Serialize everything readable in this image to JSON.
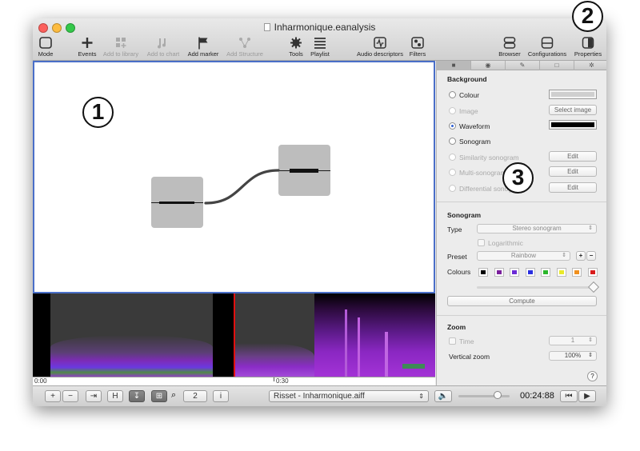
{
  "window": {
    "title": "Inharmonique.eanalysis"
  },
  "toolbar": {
    "mode": "Mode",
    "events": "Events",
    "add_to_library": "Add to library",
    "add_to_chart": "Add to chart",
    "add_marker": "Add marker",
    "add_structure": "Add Structure",
    "tools": "Tools",
    "playlist": "Playlist",
    "audio_descriptors": "Audio descriptors",
    "filters": "Filters",
    "browser": "Browser",
    "configurations": "Configurations",
    "properties": "Properties"
  },
  "timeline": {
    "start": "0:00",
    "mark": "0:30"
  },
  "bottombar": {
    "plus": "+",
    "minus": "−",
    "h": "H",
    "zoom_value": "2",
    "info": "i",
    "file": "Risset - Inharmonique.aiff",
    "time": "00:24:88"
  },
  "panel": {
    "background": {
      "title": "Background",
      "colour": "Colour",
      "image": "Image",
      "select_image": "Select image",
      "waveform": "Waveform",
      "sonogram": "Sonogram",
      "similarity": "Similarity sonogram",
      "multi": "Multi-sonogram",
      "differential": "Differential sonogram",
      "edit": "Edit"
    },
    "sonogram": {
      "title": "Sonogram",
      "type_label": "Type",
      "type_value": "Stereo sonogram",
      "logarithmic": "Logarithmic",
      "preset_label": "Preset",
      "preset_value": "Rainbow",
      "colours_label": "Colours",
      "compute": "Compute",
      "colours": [
        "#000000",
        "#7a1f9c",
        "#6b2bd6",
        "#2a2fe0",
        "#2bb62b",
        "#e9e92a",
        "#f0901e",
        "#d81c1c"
      ]
    },
    "zoom": {
      "title": "Zoom",
      "time_label": "Time",
      "time_value": "1",
      "vertical_label": "Vertical zoom",
      "vertical_value": "100%",
      "help": "?"
    }
  },
  "callouts": {
    "one": "1",
    "two": "2",
    "three": "3"
  },
  "colors": {
    "selection": "#4a6fc8",
    "playhead": "#e01010"
  }
}
